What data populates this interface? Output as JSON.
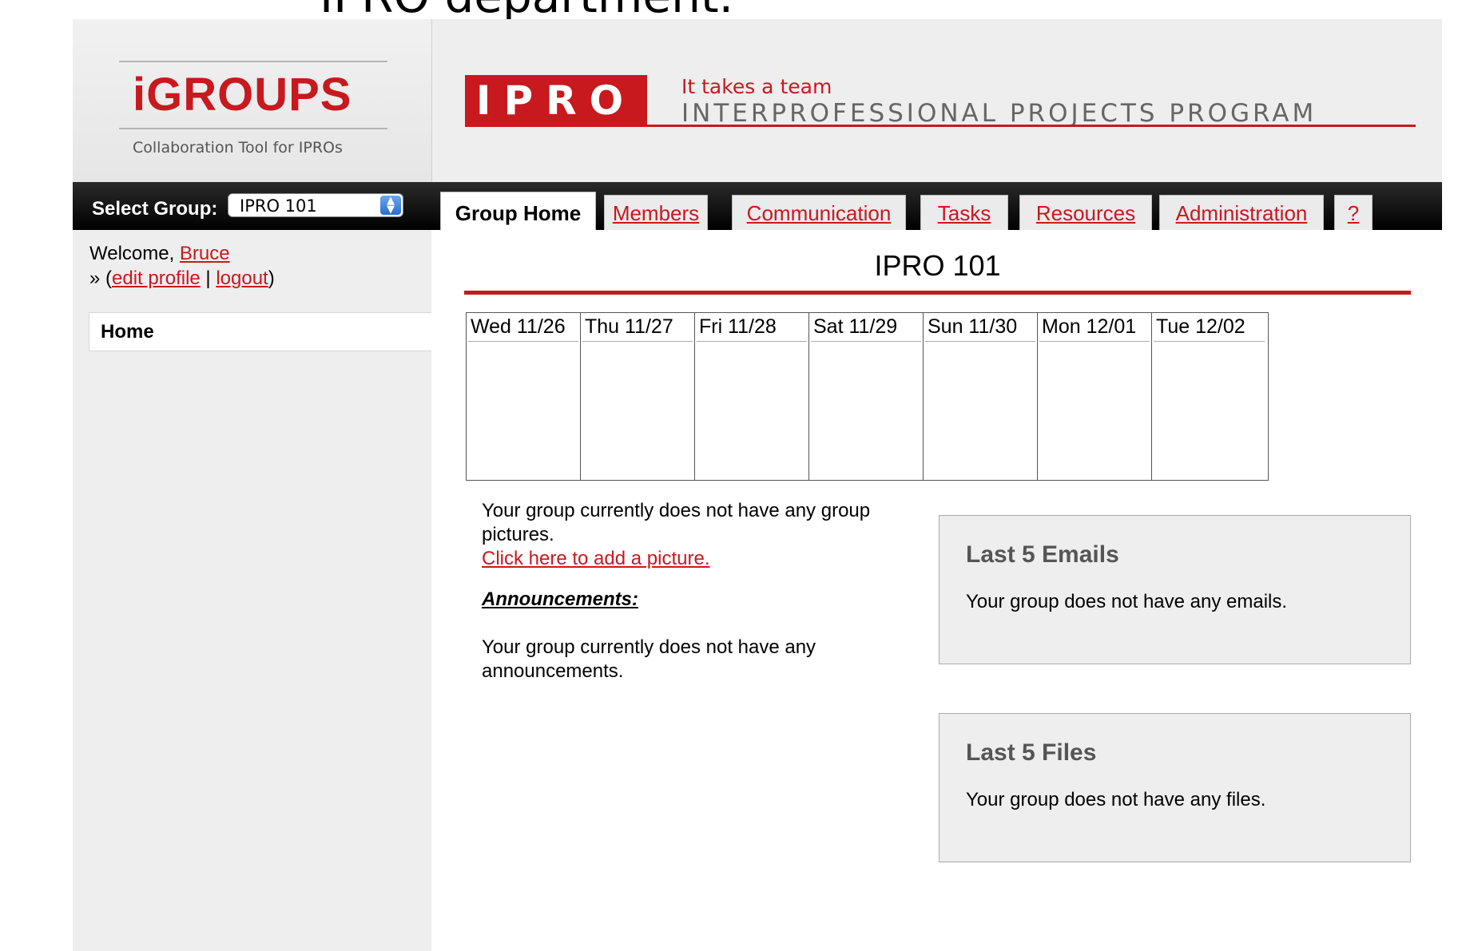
{
  "slide": {
    "title_fragment": "IPRO department."
  },
  "brand": {
    "logo": "iGROUPS",
    "tagline": "Collaboration Tool for IPROs"
  },
  "header": {
    "badge": "IPRO",
    "tagline": "It takes a team",
    "program": "INTERPROFESSIONAL PROJECTS PROGRAM"
  },
  "group_select": {
    "label": "Select Group:",
    "value": "IPRO 101"
  },
  "tabs": [
    {
      "label": "Group Home",
      "active": true
    },
    {
      "label": "Members"
    },
    {
      "label": "Communication"
    },
    {
      "label": "Tasks"
    },
    {
      "label": "Resources"
    },
    {
      "label": "Administration"
    },
    {
      "label": "?"
    }
  ],
  "sidebar": {
    "welcome_prefix": "Welcome, ",
    "user": "Bruce",
    "edit_prefix": "» (",
    "edit_profile": "edit profile",
    "separator": " | ",
    "logout": "logout",
    "edit_suffix": ")",
    "home": "Home"
  },
  "main": {
    "title": "IPRO 101",
    "calendar_days": [
      "Wed 11/26",
      "Thu 11/27",
      "Fri 11/28",
      "Sat 11/29",
      "Sun 11/30",
      "Mon 12/01",
      "Tue 12/02"
    ],
    "pictures_text": "Your group currently does not have any group pictures.",
    "add_picture": "Click here to add a picture.",
    "announcements_heading": "Announcements:",
    "announcements_text": "Your group currently does not have any announcements."
  },
  "emails_box": {
    "title": "Last 5 Emails",
    "text": "Your group does not have any emails."
  },
  "files_box": {
    "title": "Last 5 Files",
    "text": "Your group does not have any files."
  },
  "colors": {
    "accent": "#c8191e",
    "panel": "#eeeeee",
    "bar": "#111111"
  }
}
